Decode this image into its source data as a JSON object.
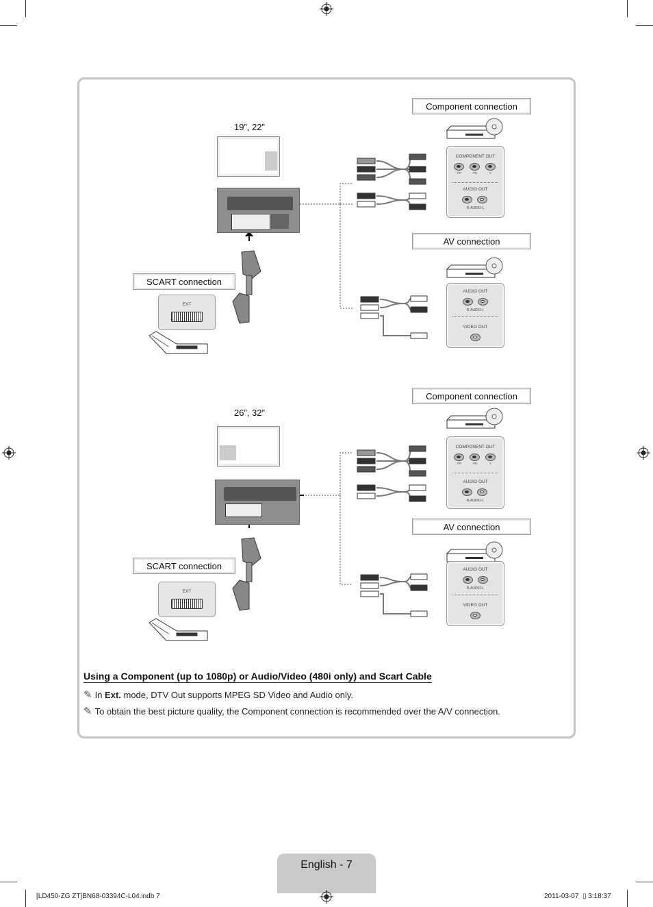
{
  "sections": [
    {
      "size_label": "19”, 22”",
      "component_label": "Component connection",
      "av_label": "AV connection",
      "scart_label": "SCART connection"
    },
    {
      "size_label": "26”, 32”",
      "component_label": "Component connection",
      "av_label": "AV connection",
      "scart_label": "SCART connection"
    }
  ],
  "panels": {
    "component_out": "COMPONENT OUT",
    "pr": "PR",
    "pb": "PB",
    "y": "Y",
    "audio_out": "AUDIO OUT",
    "r_audio_l": "R-AUDIO-L",
    "video_out": "VIDEO OUT",
    "ext": "EXT"
  },
  "heading": "Using a Component (up to 1080p) or Audio/Video (480i only) and Scart Cable",
  "notes": [
    {
      "prefix": "In ",
      "bold": "Ext.",
      "text": " mode, DTV Out supports MPEG SD Video and Audio only."
    },
    {
      "prefix": "",
      "bold": "",
      "text": "To obtain the best picture quality, the Component connection is recommended over the A/V connection."
    }
  ],
  "note_icon": "pencil-note-icon",
  "page_tab": "English - 7",
  "footer": {
    "file": "[LD450-ZG ZT]BN68-03394C-L04.indb   7",
    "date": "2011-03-07",
    "time_glyph": "▯",
    "time": "3:18:37"
  },
  "colors": {
    "frame": "#c4c4c4",
    "tab": "#c9c9c9",
    "panel": "#e4e4e4",
    "tv_back": "#8e8e8e"
  }
}
